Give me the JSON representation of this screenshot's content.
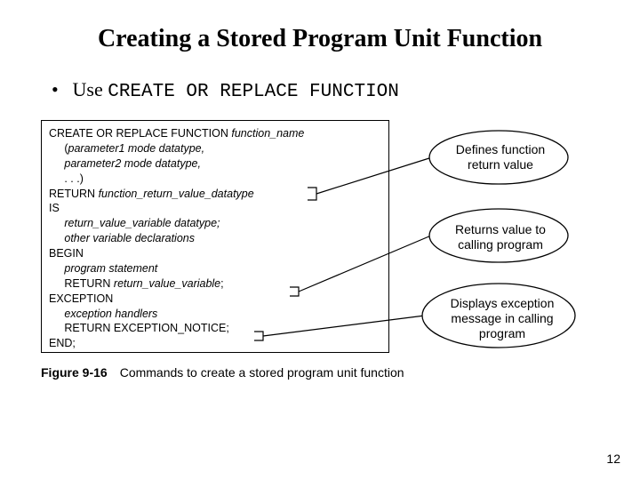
{
  "title": "Creating a Stored Program Unit Function",
  "bullet": {
    "lead": "Use ",
    "code": "CREATE OR REPLACE FUNCTION"
  },
  "code": {
    "l1a": "CREATE OR REPLACE FUNCTION ",
    "l1b": "function_name",
    "l2a": "     (",
    "l2b": "parameter1 mode datatype,",
    "l3a": "     ",
    "l3b": "parameter2 mode datatype,",
    "l4": "     . . .)",
    "l5a": "RETURN ",
    "l5b": "function_return_value_datatype",
    "l6": "IS",
    "l7a": "     ",
    "l7b": "return_value_variable datatype;",
    "l8a": "     ",
    "l8b": "other variable declarations",
    "l9": "BEGIN",
    "l10a": "     ",
    "l10b": "program statement",
    "l11a": "     RETURN ",
    "l11b": "return_value_variable",
    "l11c": ";",
    "l12": "EXCEPTION",
    "l13a": "     ",
    "l13b": "exception handlers",
    "l14": "     RETURN EXCEPTION_NOTICE;",
    "l15": "END;"
  },
  "callouts": {
    "c1": "Defines function return value",
    "c2": "Returns value to calling program",
    "c3": "Displays exception message in calling program"
  },
  "caption": {
    "fignum": "Figure 9-16",
    "text": "Commands to create a stored program unit function"
  },
  "pagenum": "12"
}
